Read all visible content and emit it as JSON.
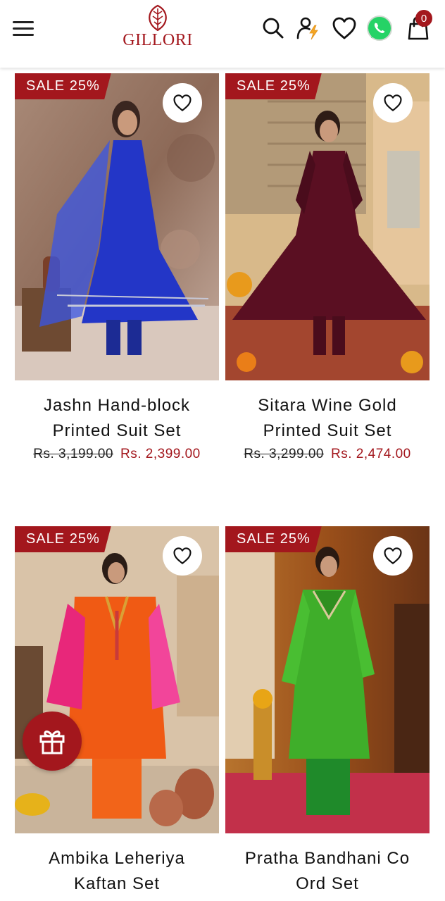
{
  "header": {
    "brand": "GILLORI",
    "cart_count": "0",
    "menu_icon": "hamburger-menu-icon",
    "search_icon": "search-icon",
    "account_icon": "user-bolt-icon",
    "wishlist_icon": "heart-icon",
    "whatsapp_icon": "whatsapp-icon",
    "cart_icon": "shopping-bag-icon"
  },
  "colors": {
    "brand": "#a3171d",
    "whatsapp": "#25d366"
  },
  "products": [
    {
      "sale_label": "SALE 25%",
      "title_line1": "Jashn Hand-block",
      "title_line2": "Printed Suit Set",
      "old_price": "Rs. 3,199.00",
      "new_price": "Rs. 2,399.00",
      "image_desc": "blue-anarkali-suit-photo"
    },
    {
      "sale_label": "SALE 25%",
      "title_line1": "Sitara Wine Gold",
      "title_line2": "Printed Suit Set",
      "old_price": "Rs. 3,299.00",
      "new_price": "Rs. 2,474.00",
      "image_desc": "wine-anarkali-suit-photo"
    },
    {
      "sale_label": "SALE 25%",
      "title_line1": "Ambika Leheriya",
      "title_line2": "Kaftan Set",
      "image_desc": "orange-kaftan-set-photo"
    },
    {
      "sale_label": "SALE 25%",
      "title_line1": "Pratha Bandhani Co",
      "title_line2": "Ord Set",
      "image_desc": "green-bandhani-set-photo"
    }
  ],
  "fab": {
    "icon": "gift-icon"
  }
}
